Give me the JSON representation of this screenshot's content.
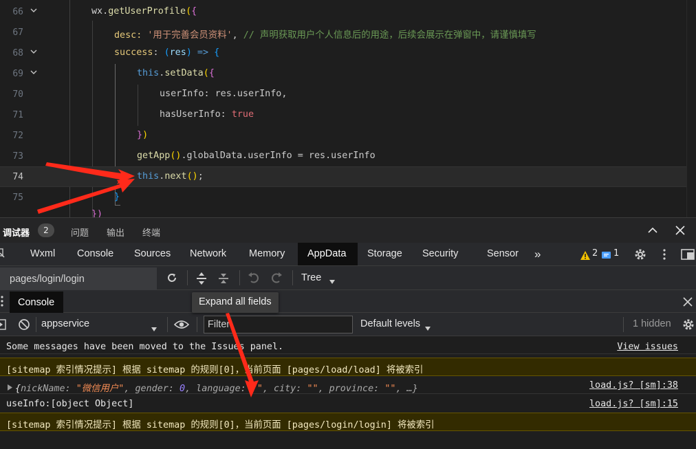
{
  "editor": {
    "lines": [
      {
        "number": "66",
        "fold": true,
        "text": "wx.getUserProfile({"
      },
      {
        "number": "67",
        "fold": false,
        "desc_key": "desc: ",
        "desc_value": "'用于完善会员资料'",
        "desc_comment": "// 声明获取用户个人信息后的用途，后续会展示在弹窗中，请谨慎填写"
      },
      {
        "number": "68",
        "fold": true,
        "text": "success: (res) => {"
      },
      {
        "number": "69",
        "fold": true,
        "text": "this.setData({"
      },
      {
        "number": "70",
        "fold": false,
        "text": "userInfo: res.userInfo,"
      },
      {
        "number": "71",
        "fold": false,
        "text": "hasUserInfo: true"
      },
      {
        "number": "72",
        "fold": false,
        "text": "})"
      },
      {
        "number": "73",
        "fold": false,
        "text": "getApp().globalData.userInfo = res.userInfo"
      },
      {
        "number": "74",
        "fold": false,
        "text": "this.next();",
        "current": true
      },
      {
        "number": "75",
        "fold": false,
        "text": "}"
      }
    ]
  },
  "devtools": {
    "topbar": {
      "tabs": [
        "调试器",
        "问题",
        "输出",
        "终端"
      ],
      "badge": "2"
    },
    "panel_tabs": [
      "Wxml",
      "Console",
      "Sources",
      "Network",
      "Memory",
      "AppData",
      "Storage",
      "Security",
      "Sensor"
    ],
    "active_panel": "AppData",
    "warnings": "2",
    "infos": "1",
    "appdata": {
      "page_path": "pages/login/login",
      "view_mode": "Tree"
    },
    "console_tab": "Console",
    "tooltip": "Expand all fields",
    "filter": {
      "context": "appservice",
      "placeholder": "Filter",
      "levels": "Default levels",
      "hidden": "1 hidden"
    },
    "messages": [
      {
        "text": "Some messages have been moved to the Issues panel.",
        "link": "View issues"
      },
      {
        "text": "[sitemap 索引情况提示] 根据 sitemap 的规则[0]，当前页面 [pages/load/load] 将被索引",
        "kind": "sitemap"
      },
      {
        "kind": "object",
        "source": "load.js? [sm]:38"
      },
      {
        "text": "useInfo:[object Object]",
        "source": "load.js? [sm]:15"
      },
      {
        "text": "[sitemap 索引情况提示] 根据 sitemap 的规则[0]，当前页面 [pages/login/login] 将被索引",
        "kind": "sitemap"
      }
    ],
    "object_preview": {
      "open": "{",
      "k1": "nickName: ",
      "v1": "\"微信用户\"",
      "k2": ", gender: ",
      "v2": "0",
      "k3": ", language: ",
      "v3": "\"\"",
      "k4": ", city: ",
      "v4": "\"\"",
      "k5": ", province: ",
      "v5": "\"\"",
      "tail": ", …}"
    }
  },
  "colors": {
    "accent_active_tab": "#0e0e0e",
    "sitemap_bg": "#332b00",
    "arrow": "#ff2a1a",
    "warning": "#f2c100",
    "info": "#4a9eff"
  }
}
